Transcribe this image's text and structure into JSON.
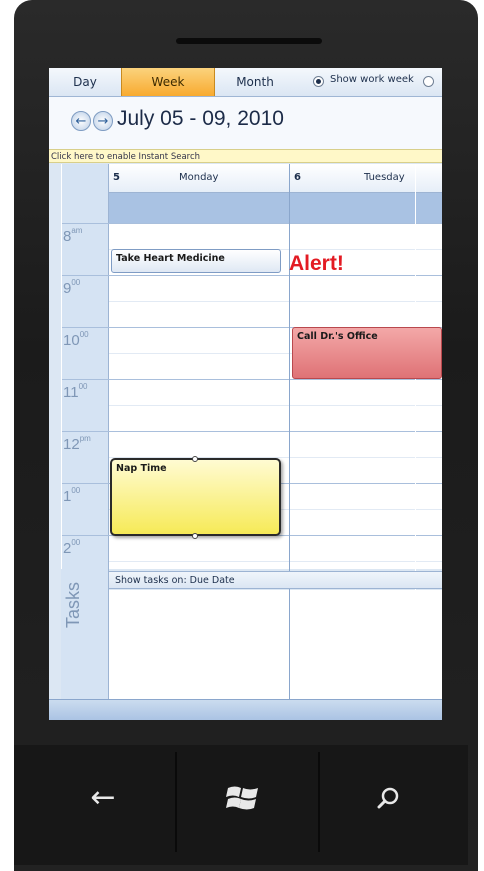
{
  "view_tabs": {
    "day": "Day",
    "week": "Week",
    "month": "Month",
    "show_work_week": "Show work week",
    "selected": "Week"
  },
  "calendar": {
    "date_range": "July 05 - 09, 2010",
    "search_text": "Click here to enable Instant Search",
    "days": [
      {
        "num": "5",
        "name": "Monday"
      },
      {
        "num": "6",
        "name": "Tuesday"
      }
    ],
    "times": [
      {
        "hour": "8",
        "suffix": "am"
      },
      {
        "hour": "9",
        "suffix": "00"
      },
      {
        "hour": "10",
        "suffix": "00"
      },
      {
        "hour": "11",
        "suffix": "00"
      },
      {
        "hour": "12",
        "suffix": "pm"
      },
      {
        "hour": "1",
        "suffix": "00"
      },
      {
        "hour": "2",
        "suffix": "00"
      }
    ],
    "events": {
      "heart": "Take Heart Medicine",
      "doctor": "Call Dr.'s Office",
      "nap": "Nap Time"
    },
    "alert": "Alert!",
    "tasks_label": "Tasks",
    "tasks_header": "Show tasks on: Due Date"
  },
  "colors": {
    "accent_tab": "#f8aa2f",
    "alert_red": "#e31b23",
    "event_red": "#df7276",
    "event_yellow": "#f6ea57"
  },
  "icons": {
    "back": "arrow-left-icon",
    "start": "windows-logo-icon",
    "search": "search-icon"
  }
}
